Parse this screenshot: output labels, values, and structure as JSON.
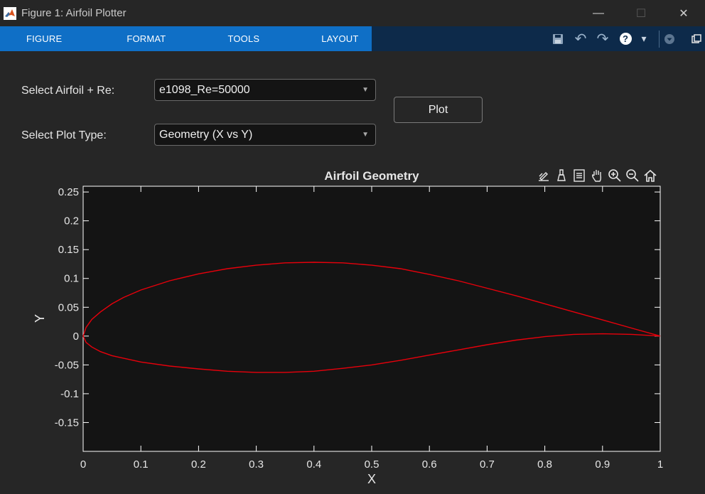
{
  "window": {
    "title": "Figure 1: Airfoil Plotter",
    "minimize_glyph": "—",
    "maximize_glyph": "☐",
    "close_glyph": "✕"
  },
  "toolstrip": {
    "tabs": [
      "FIGURE",
      "FORMAT",
      "TOOLS",
      "LAYOUT"
    ],
    "quick_access_icons": [
      "save-icon",
      "undo-icon",
      "redo-icon",
      "help-icon",
      "chevron-down-icon",
      "collapse-toolstrip-icon",
      "undock-icon"
    ],
    "help_glyph": "?",
    "chevron_glyph": "▾",
    "undo_glyph": "↶",
    "redo_glyph": "↷"
  },
  "controls": {
    "airfoil_label": "Select Airfoil + Re:",
    "airfoil_value": "e1098_Re=50000",
    "plot_type_label": "Select Plot Type:",
    "plot_type_value": "Geometry (X vs Y)",
    "plot_button": "Plot",
    "caret_glyph": "▼"
  },
  "axes_toolbar": {
    "icons": [
      "data-tips-icon",
      "brush-icon",
      "legend-icon",
      "pan-icon",
      "zoom-in-icon",
      "zoom-out-icon",
      "home-icon"
    ]
  },
  "colors": {
    "background": "#262626",
    "axes_background": "#141414",
    "tab_blue": "#0f6fc6",
    "toolstrip_navy": "#0d2a4a",
    "line": "#e8000b",
    "axis": "#ffffff"
  },
  "chart_data": {
    "type": "line",
    "title": "Airfoil Geometry",
    "xlabel": "X",
    "ylabel": "Y",
    "xlim": [
      0,
      1
    ],
    "ylim": [
      -0.2,
      0.26
    ],
    "xticks": [
      0,
      0.1,
      0.2,
      0.3,
      0.4,
      0.5,
      0.6,
      0.7,
      0.8,
      0.9,
      1
    ],
    "xtick_labels": [
      "0",
      "0.1",
      "0.2",
      "0.3",
      "0.4",
      "0.5",
      "0.6",
      "0.7",
      "0.8",
      "0.9",
      "1"
    ],
    "yticks": [
      -0.15,
      -0.1,
      -0.05,
      0,
      0.05,
      0.1,
      0.15,
      0.2,
      0.25
    ],
    "ytick_labels": [
      "-0.15",
      "-0.1",
      "-0.05",
      "0",
      "0.05",
      "0.1",
      "0.15",
      "0.2",
      "0.25"
    ],
    "grid": false,
    "series": [
      {
        "color": "#e8000b",
        "x": [
          1.0,
          0.95,
          0.9,
          0.85,
          0.8,
          0.75,
          0.7,
          0.65,
          0.6,
          0.55,
          0.5,
          0.45,
          0.4,
          0.35,
          0.3,
          0.25,
          0.2,
          0.15,
          0.1,
          0.07,
          0.05,
          0.03,
          0.015,
          0.005,
          0.0,
          0.005,
          0.015,
          0.03,
          0.05,
          0.1,
          0.15,
          0.2,
          0.25,
          0.3,
          0.35,
          0.4,
          0.45,
          0.5,
          0.55,
          0.6,
          0.65,
          0.7,
          0.75,
          0.8,
          0.85,
          0.9,
          0.95,
          1.0
        ],
        "y": [
          0.0,
          0.014,
          0.028,
          0.042,
          0.056,
          0.07,
          0.083,
          0.096,
          0.107,
          0.117,
          0.123,
          0.127,
          0.128,
          0.127,
          0.123,
          0.117,
          0.108,
          0.096,
          0.08,
          0.067,
          0.056,
          0.042,
          0.029,
          0.015,
          0.0,
          -0.011,
          -0.019,
          -0.027,
          -0.034,
          -0.045,
          -0.052,
          -0.057,
          -0.061,
          -0.063,
          -0.063,
          -0.061,
          -0.056,
          -0.05,
          -0.042,
          -0.033,
          -0.024,
          -0.015,
          -0.007,
          -0.001,
          0.003,
          0.004,
          0.003,
          0.0
        ]
      }
    ]
  }
}
